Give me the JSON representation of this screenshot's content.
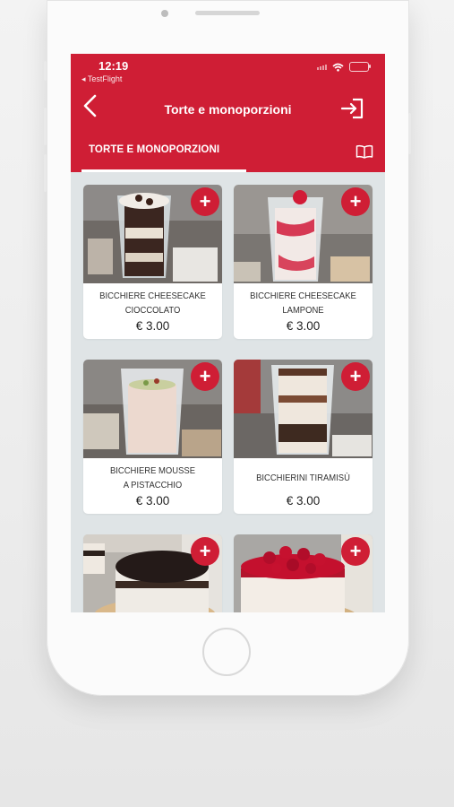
{
  "status_bar": {
    "time": "12:19",
    "back_app": "◂ TestFlight"
  },
  "nav": {
    "title": "Torte e monoporzioni"
  },
  "tabs": [
    {
      "label": "TORTE E MONOPORZIONI"
    }
  ],
  "colors": {
    "brand": "#cf1e35",
    "screen_bg": "#dfe4e6"
  },
  "icons": {
    "back": "chevron-left-icon",
    "login": "login-icon",
    "menu": "book-icon",
    "add": "plus-icon"
  },
  "products": [
    {
      "name": "BICCHIERE CHEESECAKE\nCIOCCOLATO",
      "price": "€ 3.00",
      "add_label": "+"
    },
    {
      "name": "BICCHIERE CHEESECAKE\nLAMPONE",
      "price": "€ 3.00",
      "add_label": "+"
    },
    {
      "name": "BICCHIERE MOUSSE\nA PISTACCHIO",
      "price": "€ 3.00",
      "add_label": "+"
    },
    {
      "name": "BICCHIERINI TIRAMISÙ",
      "price": "€ 3.00",
      "add_label": "+"
    },
    {
      "name": "",
      "price": "",
      "add_label": "+"
    },
    {
      "name": "",
      "price": "",
      "add_label": "+"
    }
  ]
}
